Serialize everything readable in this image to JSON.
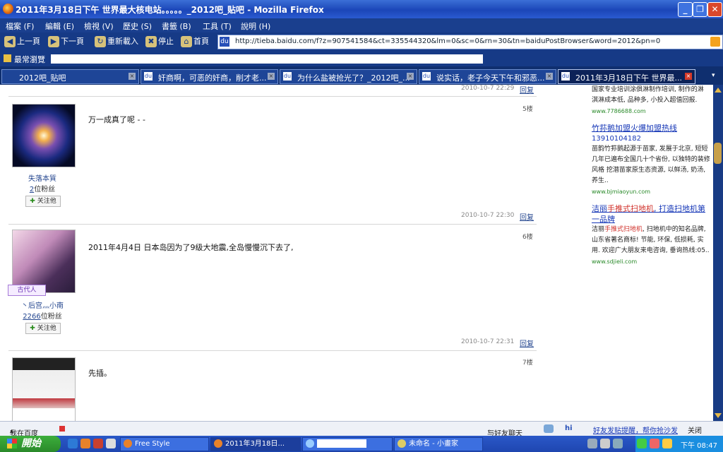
{
  "window": {
    "title": "2011年3月18日下午 世界最大核电站。。。。。_2012吧_贴吧 - Mozilla Firefox"
  },
  "menu": [
    "檔案 (F)",
    "編輯 (E)",
    "檢視 (V)",
    "歷史 (S)",
    "書籤 (B)",
    "工具 (T)",
    "說明 (H)"
  ],
  "nav": {
    "back": "上一頁",
    "forward": "下一頁",
    "reload": "重新載入",
    "stop": "停止",
    "home": "首頁",
    "url": "http://tieba.baidu.com/f?z=907541584&ct=335544320&lm=0&sc=0&rn=30&tn=baiduPostBrowser&word=2012&pn=0"
  },
  "bookmarks": {
    "most_visited": "最常瀏覽"
  },
  "tabs": [
    {
      "label": "2012吧_贴吧",
      "active": false
    },
    {
      "label": "奸商啊，可恶的奸商，削才老...",
      "active": false
    },
    {
      "label": "为什么盐被抢光了？_2012吧_...",
      "active": false
    },
    {
      "label": "说实话，老子今天下午和邪恶...",
      "active": false
    },
    {
      "label": "2011年3月18日下午 世界最...",
      "active": true
    }
  ],
  "posts": {
    "prev_meta": "2010-10-7 22:29",
    "reply_label": "回复",
    "items": [
      {
        "floor": "5楼",
        "username": "失落本質",
        "fans_count": "2",
        "fans_suffix": "位粉丝",
        "follow": "关注他",
        "content": "万一成真了呢 - -",
        "meta": "2010-10-7 22:30"
      },
      {
        "floor": "6楼",
        "tag": "古代人",
        "username": "丶后宫灬小南",
        "fans_count": "2266",
        "fans_suffix": "位粉丝",
        "follow": "关注他",
        "content": "2011年4月4日 日本岛因为了9级大地震,全岛慢慢沉下去了,",
        "meta": "2010-10-7 22:31"
      },
      {
        "floor": "7楼",
        "content": "先插。"
      }
    ]
  },
  "ads": [
    {
      "text": "国家专业培训涂俱淋制作培训, 制作的淋 淇淋成本低, 品种多, 小投入超值回报.",
      "url": "www.7786688.com"
    },
    {
      "title": "竹荪鹅加盟火爆加盟热线",
      "phone": "13910104182",
      "text": "苗韵竹荪鹅起源于苗家, 发展于北京, 短短几年已遍布全国几十个省份, 以独特的装修风格 挖潜苗家原生态资源, 以鲜汤, 奶汤, 养生..",
      "url": "www.bjmiaoyun.com"
    },
    {
      "title_pre": "洁丽",
      "title_em": "手推式扫地机",
      "title_post": ", 打造扫地机第一品牌",
      "text_pre": "洁丽",
      "text_em": "手推式扫地机",
      "text_post": ", 扫地机中的知名品牌, 山东省著名商标! 节能, 环保, 低损耗, 实用. 欢迎广大朋友来电咨询, 垂询热线:05..",
      "url": "www.sdjieli.com"
    }
  ],
  "bottombar": {
    "baidu": "我在百度",
    "chat": "与好友聊天",
    "notice": "好友发贴提醒，帮你抢沙发",
    "close": "关闭"
  },
  "taskbar": {
    "start": "開始",
    "tasks": [
      "Free Style",
      "2011年3月18日...",
      "",
      "未命名 - 小畫家"
    ],
    "clock": "下午 08:47"
  },
  "colors": {
    "accent": "#1a3f8e",
    "link": "#24468f",
    "ad_link": "#1637b7",
    "ad_url": "#2a8a2a"
  }
}
